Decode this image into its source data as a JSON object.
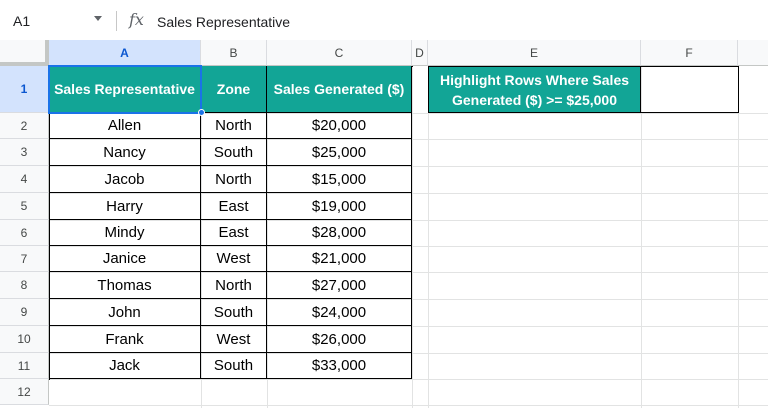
{
  "formula_bar": {
    "cell_ref": "A1",
    "fx_label": "fx",
    "content": "Sales Representative"
  },
  "columns": [
    "A",
    "B",
    "C",
    "D",
    "E",
    "F"
  ],
  "rows": [
    "1",
    "2",
    "3",
    "4",
    "5",
    "6",
    "7",
    "8",
    "9",
    "10",
    "11",
    "12"
  ],
  "table": {
    "headers": [
      "Sales Representative",
      "Zone",
      "Sales Generated ($)"
    ],
    "data": [
      [
        "Allen",
        "North",
        "$20,000"
      ],
      [
        "Nancy",
        "South",
        "$25,000"
      ],
      [
        "Jacob",
        "North",
        "$15,000"
      ],
      [
        "Harry",
        "East",
        "$19,000"
      ],
      [
        "Mindy",
        "East",
        "$28,000"
      ],
      [
        "Janice",
        "West",
        "$21,000"
      ],
      [
        "Thomas",
        "North",
        "$27,000"
      ],
      [
        "John",
        "South",
        "$24,000"
      ],
      [
        "Frank",
        "West",
        "$26,000"
      ],
      [
        "Jack",
        "South",
        "$33,000"
      ]
    ]
  },
  "note": {
    "line1": "Highlight Rows Where Sales",
    "line2": "Generated ($) >= $25,000"
  },
  "colors": {
    "header_fill": "#12a596",
    "selection": "#1a73e8"
  }
}
